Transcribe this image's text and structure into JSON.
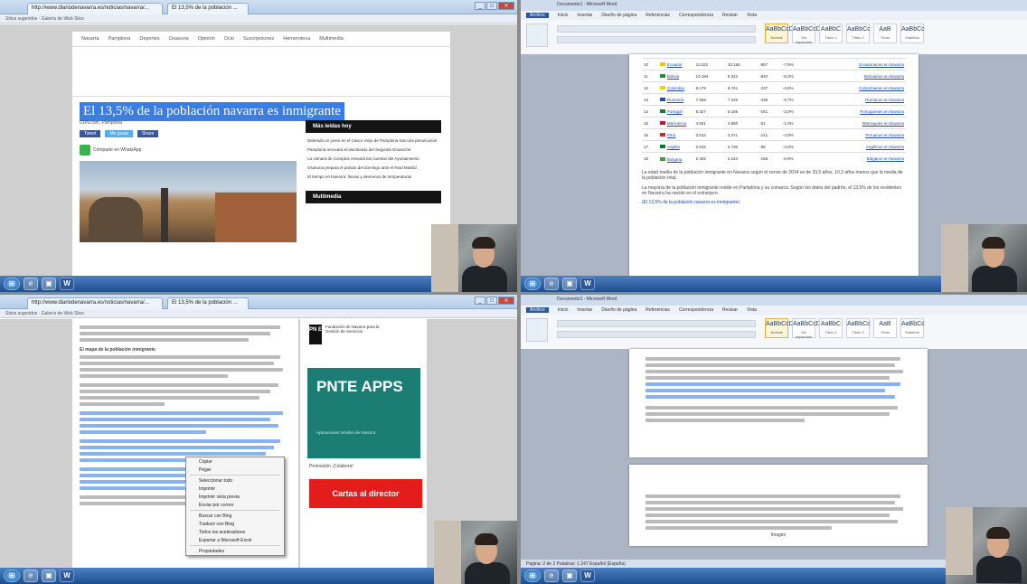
{
  "q1": {
    "tab1": "http://www.diariodenavarra.es/noticias/navarra/...",
    "tab2": "El 13,5% de la población ...",
    "favorites": [
      "Sitios sugeridos",
      "Galería de Web Slice"
    ],
    "nav": [
      "Navarra",
      "Pamplona",
      "Deportes",
      "Osasuna",
      "Opinión",
      "Ocio",
      "Suscripciones",
      "Hemeroteca",
      "Multimedia"
    ],
    "headline": "El 13,5% de la población navarra es inmigrante",
    "byline": "DDN.com, Pamplona",
    "share": [
      "Tweet",
      "Me gusta",
      "Share"
    ],
    "whatsapp": "Comparte en WhatsApp",
    "side_title": "Más leídas hoy",
    "side_items": [
      "Detenido un joven en el Casco Viejo de Pamplona tras una persecución",
      "Pamplona renovará el alumbrado del Segundo Ensanche",
      "La cámara de Comptos revisará las cuentas del Ayuntamiento",
      "Osasuna prepara el partido del domingo ante el Real Madrid",
      "El tiempo en Navarra: lluvias y descenso de temperaturas"
    ],
    "side_title2": "Multimedia"
  },
  "q2": {
    "doc_title": "Documento1 - Microsoft Word",
    "tabs": [
      "Archivo",
      "Inicio",
      "Insertar",
      "Diseño de página",
      "Referencias",
      "Correspondencia",
      "Revisar",
      "Vista"
    ],
    "styles": [
      {
        "sample": "AaBbCcDc",
        "name": "Normal"
      },
      {
        "sample": "AaBbCcDc",
        "name": "Sin espaciado"
      },
      {
        "sample": "AaBbC",
        "name": "Título 1"
      },
      {
        "sample": "AaBbCc",
        "name": "Título 2"
      },
      {
        "sample": "AaB",
        "name": "Título"
      },
      {
        "sample": "AaBbCc",
        "name": "Subtítulo"
      }
    ],
    "rows": [
      {
        "n": "10",
        "country": "Ecuador",
        "c": "#f2c500",
        "a": "11.022",
        "b": "10.165",
        "d": "-857",
        "p": "-7,8%",
        "link": "Ecuatorianos en Navarra"
      },
      {
        "n": "11",
        "country": "Bolivia",
        "c": "#2a8a3b",
        "a": "10.184",
        "b": "9.342",
        "d": "-842",
        "p": "-8,3%",
        "link": "Bolivianos en Navarra"
      },
      {
        "n": "12",
        "country": "Colombia",
        "c": "#f5d000",
        "a": "9.178",
        "b": "8.741",
        "d": "-437",
        "p": "-4,8%",
        "link": "Colombianos en Navarra"
      },
      {
        "n": "13",
        "country": "Rumanía",
        "c": "#1e4fa8",
        "a": "7.658",
        "b": "7.220",
        "d": "-438",
        "p": "-5,7%",
        "link": "Rumanos en Navarra"
      },
      {
        "n": "14",
        "country": "Portugal",
        "c": "#1a7a2e",
        "a": "5.327",
        "b": "5.166",
        "d": "-161",
        "p": "-3,0%",
        "link": "Portugueses en Navarra"
      },
      {
        "n": "15",
        "country": "Marruecos",
        "c": "#c4122d",
        "a": "4.931",
        "b": "4.880",
        "d": "-51",
        "p": "-1,0%",
        "link": "Marroquíes en Navarra"
      },
      {
        "n": "16",
        "country": "Perú",
        "c": "#d52b1e",
        "a": "3.512",
        "b": "3.371",
        "d": "-141",
        "p": "-4,0%",
        "link": "Peruanos en Navarra"
      },
      {
        "n": "17",
        "country": "Argelia",
        "c": "#0a7a3a",
        "a": "2.815",
        "b": "2.730",
        "d": "-85",
        "p": "-3,0%",
        "link": "Argelinos en Navarra"
      },
      {
        "n": "18",
        "country": "Bulgaria",
        "c": "#4a9a3a",
        "a": "2.402",
        "b": "2.244",
        "d": "-158",
        "p": "-6,6%",
        "link": "Búlgaros en Navarra"
      }
    ],
    "para1": "La edad media de la población inmigrante en Navarra según el censo de 2014 es de 33,5 años, 10,3 años menos que la media de la población total.",
    "para2": "La mayoría de la población inmigrante reside en Pamplona y su comarca. Según los datos del padrón, el 13,5% de los residentes en Navarra ha nacido en el extranjero.",
    "caption": "(El 13,5% de la población navarra es inmigrante)"
  },
  "q3": {
    "tab1": "http://www.diariodenavarra.es/noticias/navarra/...",
    "tab2": "El 13,5% de la población ...",
    "favorites": [
      "Sitios sugeridos",
      "Galería de Web Slice"
    ],
    "subtitle": "El mapa de la población inmigrante",
    "context_menu": [
      "Copiar",
      "Pegar",
      "Seleccionar todo",
      "Imprimir",
      "Imprimir vista previa",
      "Enviar por correo",
      "Buscar con Bing",
      "Traducir con Bing",
      "Todos los aceleradores",
      "Exportar a Microsoft Excel",
      "Propiedades"
    ],
    "pnte_logo": "PN E",
    "pnte_org": "Fundación de Navarra para la Gestión de Servicios",
    "pnte_title": "PNTE APPS",
    "pnte_sub": "Aplicaciones móviles de Navarra",
    "promo": "Promoción ¡Colabora!",
    "director": "Cartas al director"
  },
  "q4": {
    "doc_title": "Documento1 - Microsoft Word",
    "tabs": [
      "Archivo",
      "Inicio",
      "Insertar",
      "Diseño de página",
      "Referencias",
      "Correspondencia",
      "Revisar",
      "Vista"
    ],
    "styles": [
      {
        "sample": "AaBbCcDc",
        "name": "Normal"
      },
      {
        "sample": "AaBbCcDc",
        "name": "Sin espaciado"
      },
      {
        "sample": "AaBbC",
        "name": "Título 1"
      },
      {
        "sample": "AaBbCc",
        "name": "Título 2"
      },
      {
        "sample": "AaB",
        "name": "Título"
      },
      {
        "sample": "AaBbCc",
        "name": "Subtítulo"
      }
    ],
    "status": "Página: 2 de 2   Palabras: 1.247   Español (España)",
    "caption": "Imagen"
  }
}
